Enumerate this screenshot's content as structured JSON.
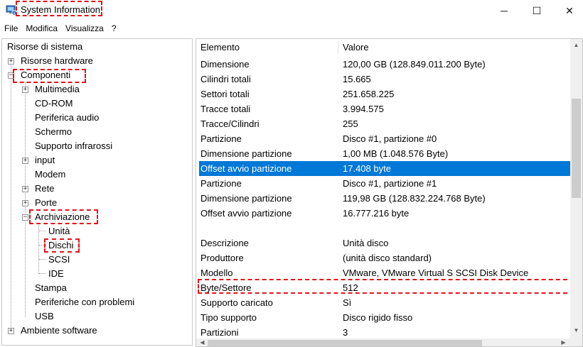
{
  "window": {
    "title": "System Information",
    "controls": {
      "minimize": "─",
      "maximize": "☐",
      "close": "✕"
    }
  },
  "menu": [
    "File",
    "Modifica",
    "Visualizza",
    "?"
  ],
  "tree": {
    "root": "Risorse di sistema",
    "items": [
      {
        "label": "Risorse hardware",
        "expander": "+"
      },
      {
        "label": "Componenti",
        "expander": "−"
      },
      {
        "label": "Multimedia",
        "expander": "+"
      },
      {
        "label": "CD-ROM"
      },
      {
        "label": "Periferica audio"
      },
      {
        "label": "Schermo"
      },
      {
        "label": "Supporto infrarossi"
      },
      {
        "label": "input",
        "expander": "+"
      },
      {
        "label": "Modem"
      },
      {
        "label": "Rete",
        "expander": "+"
      },
      {
        "label": "Porte",
        "expander": "+"
      },
      {
        "label": "Archiviazione",
        "expander": "−"
      },
      {
        "label": "Unità"
      },
      {
        "label": "Dischi"
      },
      {
        "label": "SCSI"
      },
      {
        "label": "IDE"
      },
      {
        "label": "Stampa"
      },
      {
        "label": "Periferiche con problemi"
      },
      {
        "label": "USB"
      },
      {
        "label": "Ambiente software",
        "expander": "+"
      }
    ]
  },
  "list": {
    "headers": {
      "element": "Elemento",
      "value": "Valore"
    },
    "rows": [
      {
        "element": "Dimensione",
        "value": "120,00 GB (128.849.011.200 Byte)"
      },
      {
        "element": "Cilindri totali",
        "value": "15.665"
      },
      {
        "element": "Settori totali",
        "value": "251.658.225"
      },
      {
        "element": "Tracce totali",
        "value": "3.994.575"
      },
      {
        "element": "Tracce/Cilindri",
        "value": "255"
      },
      {
        "element": "Partizione",
        "value": "Disco #1, partizione #0"
      },
      {
        "element": "Dimensione partizione",
        "value": "1,00 MB (1.048.576 Byte)"
      },
      {
        "element": "Offset avvio partizione",
        "value": "17.408 byte",
        "selected": true
      },
      {
        "element": "Partizione",
        "value": "Disco #1, partizione #1"
      },
      {
        "element": "Dimensione partizione",
        "value": "119,98 GB (128.832.224.768 Byte)"
      },
      {
        "element": "Offset avvio partizione",
        "value": "16.777.216 byte"
      },
      {
        "element": "",
        "value": ""
      },
      {
        "element": "Descrizione",
        "value": "Unità disco"
      },
      {
        "element": "Produttore",
        "value": "(unità disco standard)"
      },
      {
        "element": "Modello",
        "value": "VMware, VMware Virtual S SCSI Disk Device"
      },
      {
        "element": "Byte/Settore",
        "value": "512"
      },
      {
        "element": "Supporto caricato",
        "value": "Sì"
      },
      {
        "element": "Tipo supporto",
        "value": "Disco rigido fisso"
      },
      {
        "element": "Partizioni",
        "value": "3"
      }
    ]
  },
  "scrollbar": {
    "up": "▲",
    "down": "▼",
    "left": "◀",
    "right": "▶"
  },
  "colors": {
    "selection": "#0078d7",
    "highlight": "#e1141b"
  }
}
